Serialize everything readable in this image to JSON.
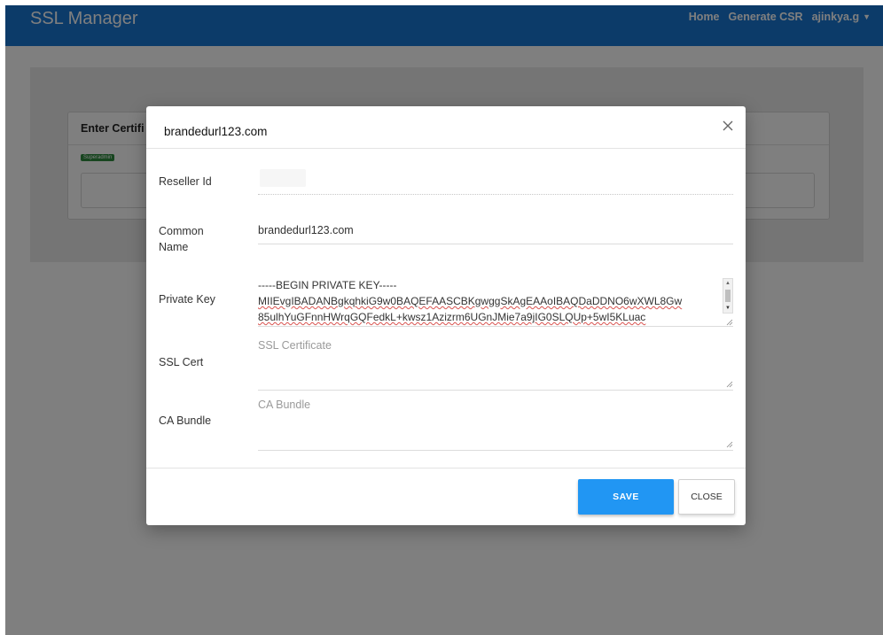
{
  "navbar": {
    "brand": "SSL Manager",
    "links": [
      "Home",
      "Generate CSR"
    ],
    "user": "ajinkya.g"
  },
  "background": {
    "card_title": "Enter Certifi",
    "badge": "Superadmin"
  },
  "modal": {
    "title": "brandedurl123.com",
    "fields": {
      "reseller_id": {
        "label": "Reseller Id"
      },
      "common_name": {
        "label": "Common Name",
        "value": "brandedurl123.com"
      },
      "private_key": {
        "label": "Private Key",
        "lines": [
          "-----BEGIN PRIVATE KEY-----",
          "MIIEvgIBADANBgkqhkiG9w0BAQEFAASCBKgwggSkAgEAAoIBAQDaDDNO6wXWL8Gw",
          "85ulhYuGFnnHWrqGQFedkL+kwsz1Azizrm6UGnJMie7a9jIG0SLQUp+5wI5KLuac"
        ]
      },
      "ssl_cert": {
        "label": "SSL Cert",
        "placeholder": "SSL Certificate"
      },
      "ca_bundle": {
        "label": "CA Bundle",
        "placeholder": "CA Bundle"
      }
    },
    "buttons": {
      "save": "SAVE",
      "close": "CLOSE"
    }
  },
  "colors": {
    "navbar": "#1976d2",
    "primary_button": "#2196f3",
    "badge": "#2e8b3e"
  },
  "icons": [
    "close-icon",
    "chevron-down-icon",
    "resize-grip-icon"
  ]
}
